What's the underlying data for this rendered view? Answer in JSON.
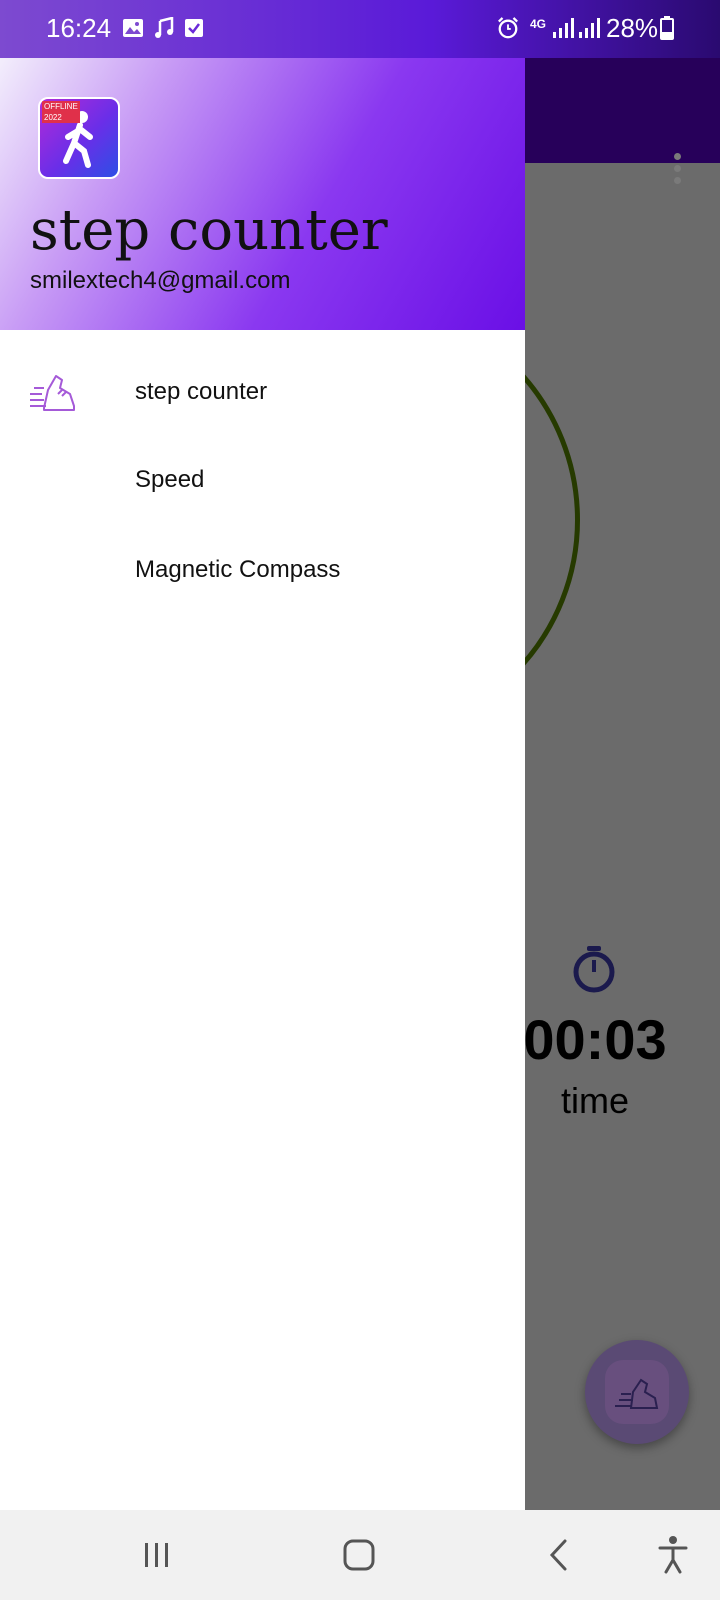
{
  "status_bar": {
    "time": "16:24",
    "network": "4G",
    "battery_text": "28%",
    "icons": [
      "image-icon",
      "music-note-icon",
      "checkbox-icon",
      "alarm-icon",
      "signal-icon",
      "signal-icon",
      "battery-icon"
    ]
  },
  "drawer": {
    "title": "step counter",
    "email": "smilextech4@gmail.com",
    "logo_badge": "OFFLINE 2022",
    "items": [
      {
        "label": "step counter",
        "icon": "shoe-icon"
      },
      {
        "label": "Speed",
        "icon": ""
      },
      {
        "label": "Magnetic Compass",
        "icon": ""
      }
    ]
  },
  "background_app": {
    "time_value": "00:03",
    "time_label": "time"
  },
  "colors": {
    "header_gradient_start": "#f3eefc",
    "header_gradient_end": "#6a0fe6",
    "app_bar": "#27005a",
    "scrim": "#6b6b6b"
  }
}
